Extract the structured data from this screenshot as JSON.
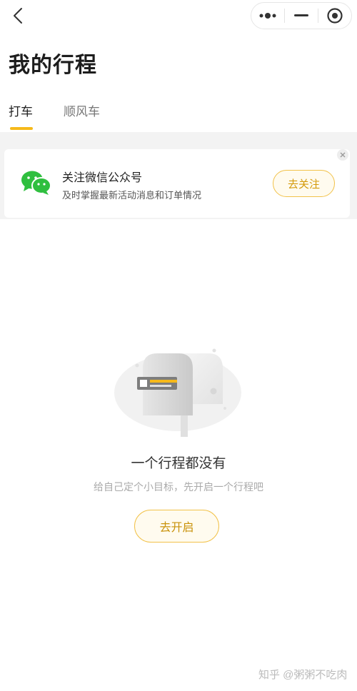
{
  "header": {
    "page_title": "我的行程"
  },
  "tabs": [
    {
      "label": "打车",
      "active": true
    },
    {
      "label": "顺风车",
      "active": false
    }
  ],
  "banner": {
    "title": "关注微信公众号",
    "subtitle": "及时掌握最新活动消息和订单情况",
    "follow_label": "去关注"
  },
  "empty_state": {
    "title": "一个行程都没有",
    "subtitle": "给自己定个小目标，先开启一个行程吧",
    "button_label": "去开启"
  },
  "watermark": "知乎 @粥粥不吃肉",
  "colors": {
    "accent": "#f6b91a",
    "button_text": "#d49a0b",
    "button_bg": "#fffbef",
    "wechat_green": "#2fbf3f"
  },
  "icons": [
    "back-icon",
    "more-dots-icon",
    "minimize-icon",
    "close-target-icon",
    "banner-close-icon",
    "wechat-icon",
    "mailbox-illustration"
  ]
}
